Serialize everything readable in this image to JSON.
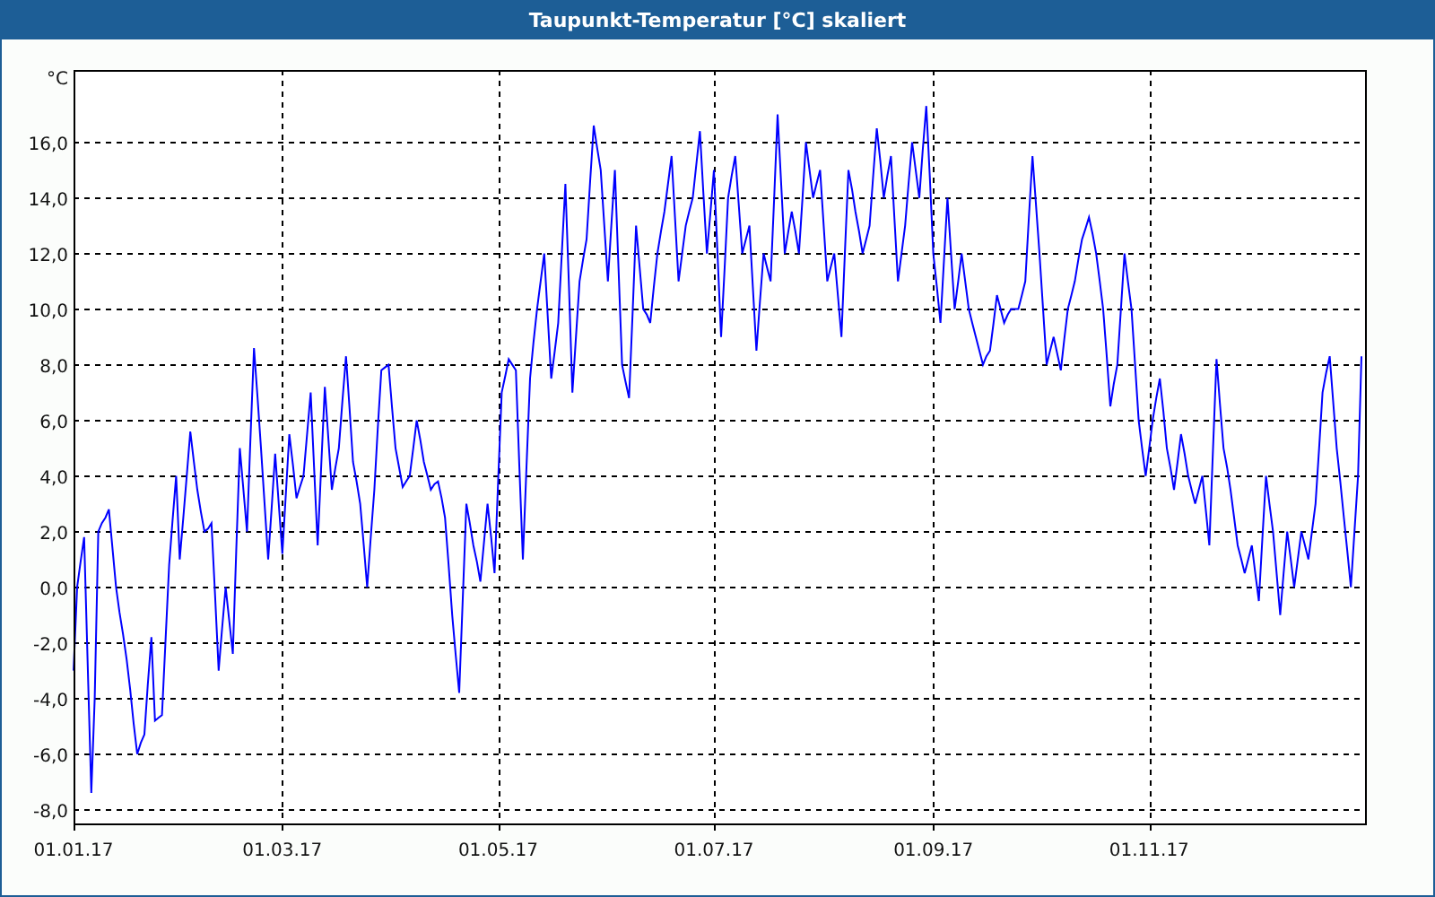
{
  "window": {
    "title": "Taupunkt-Temperatur [°C] skaliert"
  },
  "chart": {
    "chart_data": {
      "type": "line",
      "grid": true,
      "ylabel": "°C",
      "ylim": [
        -8.5,
        18.6
      ],
      "categories": [
        "01.01.17",
        null,
        null,
        null,
        null,
        null,
        null,
        null,
        null,
        null,
        null,
        null,
        null,
        null,
        null,
        null,
        null,
        null,
        null,
        null,
        null,
        null,
        null,
        null,
        null,
        null,
        null,
        null,
        null,
        null,
        null,
        null,
        null,
        null,
        null,
        null,
        null,
        null,
        null,
        null,
        null,
        null,
        null,
        null,
        null,
        null,
        null,
        null,
        null,
        null,
        null,
        null,
        null,
        null,
        null,
        null,
        null,
        null,
        null,
        "01.03.17",
        null,
        null,
        null,
        null,
        null,
        null,
        null,
        null,
        null,
        null,
        null,
        null,
        null,
        null,
        null,
        null,
        null,
        null,
        null,
        null,
        null,
        null,
        null,
        null,
        null,
        null,
        null,
        null,
        null,
        null,
        null,
        null,
        null,
        null,
        null,
        null,
        null,
        null,
        null,
        null,
        null,
        null,
        null,
        null,
        null,
        null,
        null,
        null,
        null,
        null,
        null,
        null,
        null,
        null,
        null,
        null,
        null,
        null,
        null,
        null,
        "01.05.17",
        null,
        null,
        null,
        null,
        null,
        null,
        null,
        null,
        null,
        null,
        null,
        null,
        null,
        null,
        null,
        null,
        null,
        null,
        null,
        null,
        null,
        null,
        null,
        null,
        null,
        null,
        null,
        null,
        null,
        null,
        null,
        null,
        null,
        null,
        null,
        null,
        null,
        null,
        null,
        null,
        null,
        null,
        null,
        null,
        null,
        null,
        null,
        null,
        null,
        null,
        null,
        null,
        null,
        null,
        null,
        null,
        null,
        null,
        null,
        null,
        "01.07.17",
        null,
        null,
        null,
        null,
        null,
        null,
        null,
        null,
        null,
        null,
        null,
        null,
        null,
        null,
        null,
        null,
        null,
        null,
        null,
        null,
        null,
        null,
        null,
        null,
        null,
        null,
        null,
        null,
        null,
        null,
        null,
        null,
        null,
        null,
        null,
        null,
        null,
        null,
        null,
        null,
        null,
        null,
        null,
        null,
        null,
        null,
        null,
        null,
        null,
        null,
        null,
        null,
        null,
        null,
        null,
        null,
        null,
        null,
        null,
        null,
        null,
        "01.09.17",
        null,
        null,
        null,
        null,
        null,
        null,
        null,
        null,
        null,
        null,
        null,
        null,
        null,
        null,
        null,
        null,
        null,
        null,
        null,
        null,
        null,
        null,
        null,
        null,
        null,
        null,
        null,
        null,
        null,
        null,
        null,
        null,
        null,
        null,
        null,
        null,
        null,
        null,
        null,
        null,
        null,
        null,
        null,
        null,
        null,
        null,
        null,
        null,
        null,
        null,
        null,
        null,
        null,
        null,
        null,
        null,
        null,
        null,
        null,
        null,
        "01.11.17",
        null,
        null,
        null,
        null,
        null,
        null,
        null,
        null,
        null,
        null,
        null,
        null,
        null,
        null,
        null,
        null,
        null,
        null,
        null,
        null,
        null,
        null,
        null,
        null,
        null,
        null,
        null,
        null,
        null,
        null,
        null,
        null,
        null,
        null,
        null,
        null,
        null,
        null,
        null,
        null,
        null,
        null,
        null,
        null,
        null,
        null,
        null,
        null,
        null,
        null,
        null,
        null,
        null,
        null,
        null,
        null,
        null,
        null,
        null,
        null
      ],
      "yticks": [
        {
          "value": -8,
          "label": "-8,0"
        },
        {
          "value": -6,
          "label": "-6,0"
        },
        {
          "value": -4,
          "label": "-4,0"
        },
        {
          "value": -2,
          "label": "-2,0"
        },
        {
          "value": 0,
          "label": "0,0"
        },
        {
          "value": 2,
          "label": "2,0"
        },
        {
          "value": 4,
          "label": "4,0"
        },
        {
          "value": 6,
          "label": "6,0"
        },
        {
          "value": 8,
          "label": "8,0"
        },
        {
          "value": 10,
          "label": "10,0"
        },
        {
          "value": 12,
          "label": "12,0"
        },
        {
          "value": 14,
          "label": "14,0"
        },
        {
          "value": 16,
          "label": "16,0"
        }
      ],
      "series": [
        {
          "color": "#0000ff",
          "values": [
            -3,
            0,
            0.9,
            1.8,
            -2.8,
            -7.4,
            -4,
            2,
            2.3,
            2.5,
            2.8,
            1.4,
            0,
            -0.9,
            -1.7,
            -2.6,
            -3.7,
            -4.9,
            -6,
            -5.6,
            -5.3,
            -3.5,
            -1.8,
            -4.8,
            -4.7,
            -4.6,
            -1.9,
            0.8,
            2.4,
            4,
            1,
            2.5,
            4,
            5.6,
            4.5,
            3.5,
            2.7,
            2,
            2.1,
            2.3,
            -0.3,
            -3,
            -1.5,
            0,
            -1.2,
            -2.4,
            1.3,
            5,
            3.5,
            2,
            5.3,
            8.6,
            6.8,
            5,
            3,
            1,
            2.9,
            4.8,
            3,
            1.2,
            3.4,
            5.5,
            4.4,
            3.2,
            3.6,
            4,
            5.5,
            7,
            4.3,
            1.5,
            4.4,
            7.2,
            5.4,
            3.5,
            4.3,
            5,
            6.7,
            8.3,
            6.4,
            4.5,
            3.8,
            3,
            1.5,
            0,
            1.8,
            3.5,
            5.7,
            7.8,
            7.9,
            8,
            6.5,
            5,
            4.3,
            3.6,
            3.8,
            4,
            5,
            6,
            5.3,
            4.5,
            4,
            3.5,
            3.7,
            3.8,
            3.2,
            2.5,
            0.8,
            -1,
            -2.4,
            -3.8,
            -0.4,
            3,
            2.3,
            1.5,
            0.9,
            0.2,
            1.6,
            3,
            1.8,
            0.5,
            3.8,
            7,
            7.6,
            8.2,
            8,
            7.8,
            4.4,
            1,
            4.3,
            7.5,
            8.8,
            10,
            11,
            12,
            9.8,
            7.5,
            8.5,
            9.5,
            12,
            14.5,
            10.8,
            7,
            9,
            11,
            11.8,
            12.5,
            14.6,
            16.6,
            15.8,
            15,
            13,
            11,
            13,
            15,
            11.5,
            8,
            7.4,
            6.8,
            9.9,
            13,
            11.5,
            10,
            9.8,
            9.5,
            10.8,
            12,
            12.8,
            13.5,
            14.5,
            15.5,
            13.3,
            11,
            12,
            13,
            13.5,
            14,
            15.2,
            16.4,
            14.2,
            12,
            13.5,
            15,
            12,
            9,
            11.5,
            14,
            14.8,
            15.5,
            13.8,
            12,
            12.5,
            13,
            10.8,
            8.5,
            10.3,
            12,
            11.5,
            11,
            14,
            17,
            14.5,
            12,
            12.8,
            13.5,
            12.8,
            12,
            14,
            16,
            15,
            14,
            14.5,
            15,
            13,
            11,
            11.5,
            12,
            10.5,
            9,
            12,
            15,
            14.3,
            13.5,
            12.8,
            12,
            12.5,
            13,
            14.8,
            16.5,
            15.3,
            14,
            14.8,
            15.5,
            13.3,
            11,
            12,
            13,
            14.5,
            16,
            15,
            14,
            15.7,
            17.3,
            14.7,
            12,
            10.8,
            9.5,
            11.8,
            14,
            12,
            10,
            11,
            12,
            11,
            10,
            9.5,
            9,
            8.5,
            8,
            8.3,
            8.5,
            9.5,
            10.5,
            10,
            9.5,
            9.8,
            10,
            10,
            10,
            10.5,
            11,
            13.3,
            15.5,
            13.8,
            12,
            10,
            8,
            8.5,
            9,
            8.4,
            7.8,
            8.9,
            10,
            10.5,
            11,
            11.8,
            12.5,
            12.9,
            13.3,
            12.7,
            12,
            11,
            10,
            8.3,
            6.5,
            7.3,
            8,
            10,
            12,
            11,
            10,
            8,
            6,
            5,
            4,
            5,
            6,
            6.8,
            7.5,
            6.3,
            5,
            4.3,
            3.5,
            4.5,
            5.5,
            4.8,
            4,
            3.5,
            3,
            3.5,
            4,
            2.8,
            1.5,
            4.9,
            8.2,
            6.6,
            5,
            4.3,
            3.5,
            2.5,
            1.5,
            1,
            0.5,
            1,
            1.5,
            0.5,
            -0.5,
            1.8,
            4,
            3,
            2,
            0.5,
            -1,
            0.5,
            2,
            1,
            0,
            1,
            2,
            1.5,
            1,
            2,
            3,
            5,
            7,
            7.7,
            8.3,
            6.7,
            5,
            3.8,
            2.5,
            1.3,
            0,
            2,
            4,
            8.3
          ]
        }
      ]
    }
  }
}
